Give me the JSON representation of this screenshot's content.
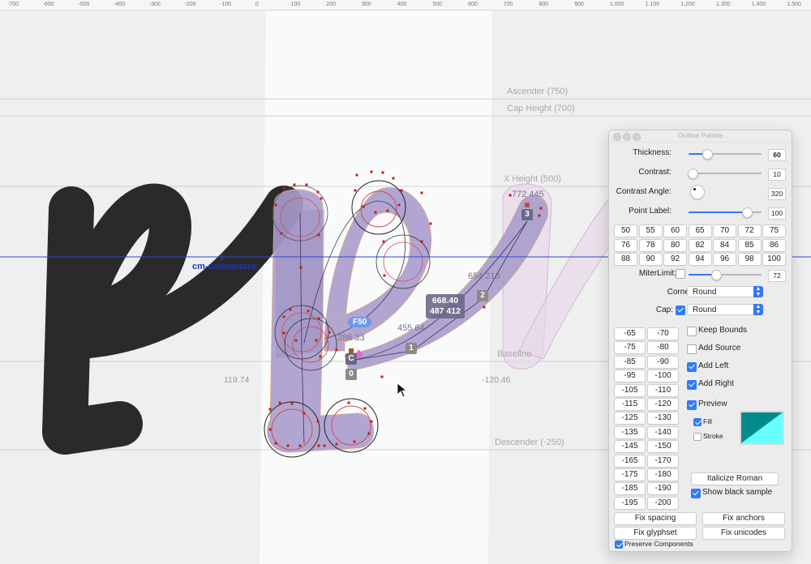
{
  "ruler": {
    "ticks": [
      "-700",
      "-600",
      "-500",
      "-400",
      "-300",
      "-200",
      "-100",
      "0",
      "100",
      "200",
      "300",
      "400",
      "500",
      "600",
      "700",
      "800",
      "900",
      "1.000",
      "1.100",
      "1.200",
      "1.300",
      "1.400",
      "1.500"
    ]
  },
  "canvas": {
    "metrics": {
      "ascender": "Ascender (750)",
      "cap_height": "Cap Height (700)",
      "x_height": "X Height (500)",
      "baseline": "Baseline",
      "descender": "Descender (-250)"
    },
    "sidebearings": {
      "left": "119.74",
      "right": "-120.46"
    },
    "anchor_name": "cm-connectors",
    "coordinates": {
      "pt_286": "286 33",
      "pt_455": "455 64",
      "pt_654": "654 213",
      "pt_772": "772 445"
    },
    "selection_info": {
      "line1": "668.40",
      "line2": "487 412"
    },
    "point_badges": [
      "0",
      "C",
      "1",
      "2",
      "3"
    ],
    "f_label": "F50",
    "colors": {
      "stroke_fill": "#a99ccc",
      "dark_glyph": "#2a2a2a",
      "preview_glyph": "#e8d5e8",
      "metric_line": "#c8c8c8",
      "anchor_line": "#3344cc",
      "node_red": "#cc1a1a"
    }
  },
  "palette": {
    "title": "Outline Palette",
    "thickness": {
      "label": "Thickness:",
      "value": "60",
      "fraction": 0.25
    },
    "contrast": {
      "label": "Contrast:",
      "value": "10",
      "fraction": 0.06
    },
    "contrast_angle": {
      "label": "Contrast Angle:",
      "value": "320"
    },
    "point_label": {
      "label": "Point Label:",
      "value": "100",
      "fraction": 0.8
    },
    "preset_rows": [
      [
        "50",
        "55",
        "60",
        "65",
        "70",
        "72",
        "75"
      ],
      [
        "76",
        "78",
        "80",
        "82",
        "84",
        "85",
        "86"
      ],
      [
        "88",
        "90",
        "92",
        "94",
        "96",
        "98",
        "100"
      ]
    ],
    "miter_limit": {
      "label": "MiterLimit:",
      "value": "72",
      "fraction": 0.38,
      "checked": false
    },
    "corner": {
      "label": "Corner:",
      "value": "Round"
    },
    "cap": {
      "label": "Cap:",
      "value": "Round",
      "checked": true
    },
    "offset_buttons": [
      [
        "-65",
        "-70"
      ],
      [
        "-75",
        "-80"
      ],
      [
        "-85",
        "-90"
      ],
      [
        "-95",
        "-100"
      ],
      [
        "-105",
        "-110"
      ],
      [
        "-115",
        "-120"
      ],
      [
        "-125",
        "-130"
      ],
      [
        "-135",
        "-140"
      ],
      [
        "-145",
        "-150"
      ],
      [
        "-165",
        "-170"
      ],
      [
        "-175",
        "-180"
      ],
      [
        "-185",
        "-190"
      ],
      [
        "-195",
        "-200"
      ]
    ],
    "options": {
      "keep_bounds": {
        "label": "Keep Bounds",
        "checked": false
      },
      "add_source": {
        "label": "Add Source",
        "checked": false
      },
      "add_left": {
        "label": "Add Left",
        "checked": true
      },
      "add_right": {
        "label": "Add Right",
        "checked": true
      },
      "preview": {
        "label": "Preview",
        "checked": true
      },
      "fill": {
        "label": "Fill",
        "checked": true
      },
      "stroke": {
        "label": "Stroke",
        "checked": false
      },
      "show_black_sample": {
        "label": "Show black sample",
        "checked": true
      },
      "preserve_components": {
        "label": "Preserve Components",
        "checked": true
      }
    },
    "swatch_colors": {
      "dark": "#008b8b",
      "light": "#66ffff"
    },
    "buttons": {
      "italicize_roman": "Italicize Roman",
      "fix_spacing": "Fix spacing",
      "fix_anchors": "Fix anchors",
      "fix_glyphset": "Fix glyphset",
      "fix_unicodes": "Fix unicodes"
    }
  }
}
